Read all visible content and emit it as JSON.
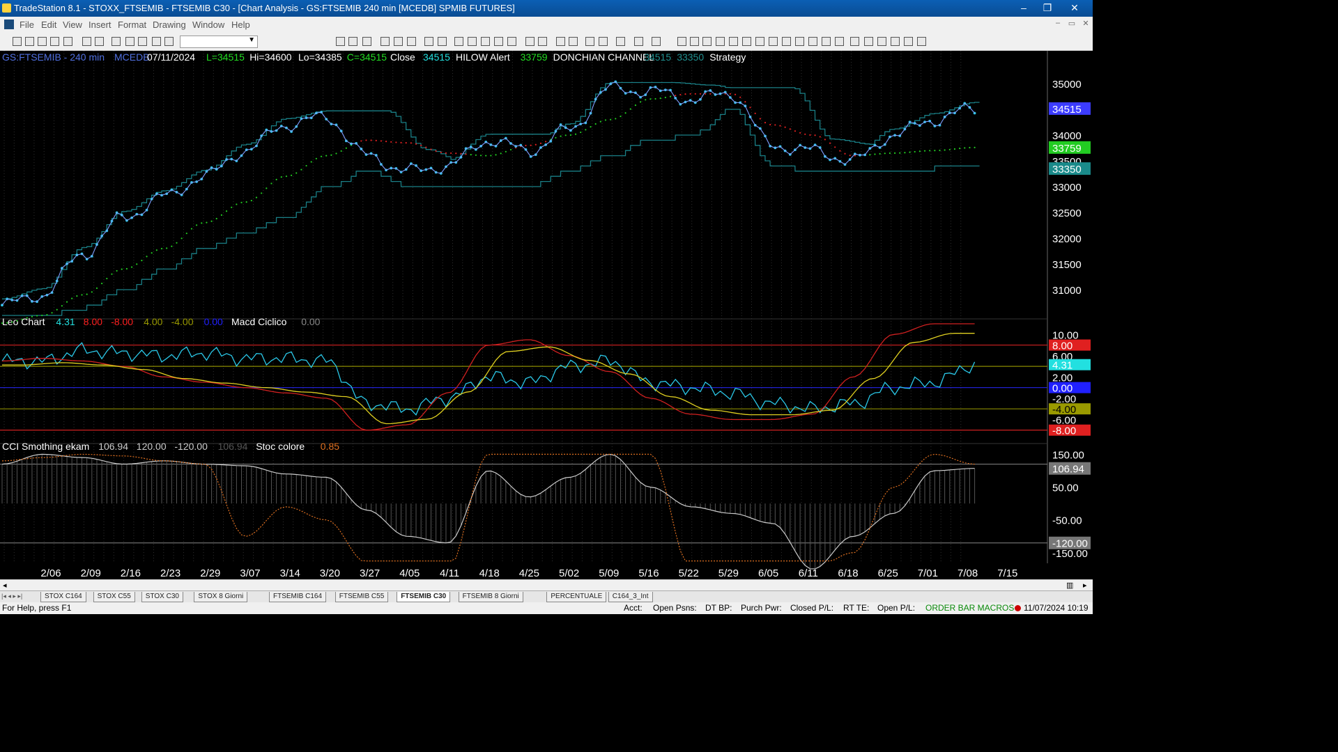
{
  "window": {
    "title": "TradeStation 8.1 - STOXX_FTSEMIB - FTSEMIB C30 - [Chart Analysis - GS:FTSEMIB  240 min  [MCEDB] SPMIB FUTURES]",
    "buttons": [
      "–",
      "❐",
      "✕"
    ]
  },
  "menu": [
    "File",
    "Edit",
    "View",
    "Insert",
    "Format",
    "Drawing",
    "Window",
    "Help"
  ],
  "mdi_buttons": [
    "–",
    "▭",
    "✕"
  ],
  "toolbar": {
    "symbol_value": ""
  },
  "header1": [
    {
      "t": "GS:FTSEMIB - 240 min",
      "c": "#4f6fe0"
    },
    {
      "t": "MCEDB",
      "c": "#4f6fe0"
    },
    {
      "t": "07/11/2024",
      "c": "#ffffff"
    },
    {
      "t": "L=34515",
      "c": "#22dd22"
    },
    {
      "t": "Hi=34600",
      "c": "#ffffff"
    },
    {
      "t": "Lo=34385",
      "c": "#ffffff"
    },
    {
      "t": "C=34515",
      "c": "#22dd22"
    },
    {
      "t": "Close",
      "c": "#ffffff"
    },
    {
      "t": "34515",
      "c": "#22e0e0"
    },
    {
      "t": "HILOW Alert",
      "c": "#ffffff"
    },
    {
      "t": "33759",
      "c": "#22dd22"
    },
    {
      "t": "DONCHIAN CHANNEL",
      "c": "#ffffff"
    },
    {
      "t": "34515",
      "c": "#1f8f8f"
    },
    {
      "t": "33350",
      "c": "#1f8f8f"
    },
    {
      "t": "Strategy",
      "c": "#ffffff"
    }
  ],
  "header2": [
    {
      "t": "Leo Chart",
      "c": "#ffffff"
    },
    {
      "t": "4.31",
      "c": "#22e0e0"
    },
    {
      "t": "8.00",
      "c": "#ff2020"
    },
    {
      "t": "-8.00",
      "c": "#ff2020"
    },
    {
      "t": "4.00",
      "c": "#9a9a00"
    },
    {
      "t": "-4.00",
      "c": "#9a9a00"
    },
    {
      "t": "0.00",
      "c": "#2020ff"
    },
    {
      "t": "Macd Ciclico",
      "c": "#ffffff"
    },
    {
      "t": "0.00",
      "c": "#888888"
    }
  ],
  "header3": [
    {
      "t": "CCI Smothing ekam",
      "c": "#ffffff"
    },
    {
      "t": "106.94",
      "c": "#cccccc"
    },
    {
      "t": "120.00",
      "c": "#cccccc"
    },
    {
      "t": "-120.00",
      "c": "#cccccc"
    },
    {
      "t": "106.94",
      "c": "#555555"
    },
    {
      "t": "Stoc colore",
      "c": "#ffffff"
    },
    {
      "t": "0.85",
      "c": "#e07020"
    }
  ],
  "colors": {
    "price": "#2ac8e8",
    "donchian": "#1a7f86",
    "red_ma": "#e02020",
    "green_ma": "#22cc22",
    "grid": "#303030"
  },
  "chart_data": [
    {
      "type": "line",
      "panel": "price",
      "x": [
        "2/06",
        "2/09",
        "2/16",
        "2/23",
        "2/29",
        "3/07",
        "3/14",
        "3/20",
        "3/27",
        "4/05",
        "4/11",
        "4/18",
        "4/25",
        "5/02",
        "5/09",
        "5/16",
        "5/22",
        "5/29",
        "6/05",
        "6/11",
        "6/18",
        "6/25",
        "7/01",
        "7/08",
        "7/15"
      ],
      "yticks": [
        31000,
        31500,
        32000,
        32500,
        33000,
        33500,
        34000,
        34500,
        35000
      ],
      "ylim": [
        30500,
        35500
      ],
      "series": [
        {
          "name": "Close",
          "values": [
            30700,
            30900,
            31700,
            32400,
            32800,
            33200,
            33700,
            34200,
            34350,
            33600,
            33300,
            33400,
            33900,
            33700,
            34100,
            34900,
            34850,
            34700,
            34800,
            33800,
            33700,
            33500,
            34000,
            34300,
            34515
          ]
        },
        {
          "name": "HILOW Alert",
          "values": [
            30350,
            30500,
            30900,
            31400,
            31800,
            32300,
            32700,
            33200,
            33600,
            33900,
            33850,
            33650,
            33600,
            33800,
            34000,
            34300,
            34700,
            34800,
            34800,
            34200,
            34000,
            33600,
            33650,
            33700,
            33759
          ]
        },
        {
          "name": "DONCHIAN CHANNEL",
          "values": [
            30450,
            30500,
            30650,
            31000,
            31400,
            31800,
            32100,
            32400,
            33000,
            33300,
            33000,
            33000,
            33000,
            33000,
            33300,
            33600,
            33900,
            34000,
            34500,
            33400,
            33300,
            33300,
            33300,
            33350,
            33350
          ]
        }
      ],
      "labels": [
        {
          "t": "34515",
          "v": 34515,
          "c": "#3c3cff"
        },
        {
          "t": "33759",
          "v": 33759,
          "c": "#22cc22"
        },
        {
          "t": "33350",
          "v": 33350,
          "c": "#1a8a8a"
        }
      ]
    },
    {
      "type": "line",
      "panel": "Leo Chart",
      "yticks": [
        10,
        6,
        2,
        -2,
        -6
      ],
      "ytick_labels": [
        "10.00",
        "6.00",
        "2.00",
        "-2.00",
        "-6.00"
      ],
      "ylim": [
        -10,
        12
      ],
      "hlines": [
        8,
        4,
        0,
        -4,
        -8
      ],
      "series": [
        {
          "name": "Leo Chart",
          "values": [
            5,
            5,
            7,
            6.5,
            6,
            6.5,
            5.5,
            5.5,
            5,
            -3,
            -4,
            -2,
            2,
            1,
            4,
            5,
            1,
            0,
            -1,
            -3,
            -4,
            -3,
            0,
            1,
            4.31
          ]
        },
        {
          "name": "Macd Ciclico",
          "values": [
            5,
            5.5,
            5,
            4,
            2,
            1,
            0,
            -1,
            -2,
            -8,
            -7,
            -1,
            8,
            9,
            6,
            3,
            -2,
            -5,
            -6,
            -6,
            -5,
            2,
            10,
            12,
            12
          ]
        }
      ],
      "labels": [
        {
          "t": "8.00",
          "v": 8,
          "c": "#e02020"
        },
        {
          "t": "4.31",
          "v": 4.31,
          "c": "#22e0e0"
        },
        {
          "t": "0.00",
          "v": 0,
          "c": "#2020ff"
        },
        {
          "t": "-4.00",
          "v": -4,
          "c": "#9a9a00"
        },
        {
          "t": "-8.00",
          "v": -8,
          "c": "#e02020"
        }
      ]
    },
    {
      "type": "line",
      "panel": "CCI Smothing ekam",
      "yticks": [
        150,
        50,
        -50,
        -150
      ],
      "ytick_labels": [
        "150.00",
        "50.00",
        "-50.00",
        "-150.00"
      ],
      "ylim": [
        -180,
        170
      ],
      "hlines": [
        120,
        -120
      ],
      "series": [
        {
          "name": "CCI Smothing ekam",
          "values": [
            120,
            150,
            140,
            120,
            130,
            120,
            115,
            90,
            80,
            -20,
            -100,
            -120,
            100,
            20,
            80,
            150,
            50,
            -10,
            -30,
            -60,
            -200,
            -100,
            -30,
            100,
            106.94
          ]
        },
        {
          "name": "Stoc colore",
          "values": [
            130,
            140,
            150,
            145,
            130,
            120,
            -100,
            -10,
            -50,
            -180,
            -200,
            -200,
            150,
            150,
            150,
            150,
            150,
            -200,
            -200,
            -200,
            -200,
            -150,
            50,
            150,
            120
          ]
        }
      ],
      "labels": [
        {
          "t": "106.94",
          "v": 106.94,
          "c": "#888888"
        },
        {
          "t": "-120.00",
          "v": -120,
          "c": "#888888"
        }
      ]
    }
  ],
  "tabs": [
    "STOX C164",
    "STOX C55",
    "STOX  C30",
    "STOX  8 Giorni",
    "FTSEMIB C164",
    "FTSEMIB C55",
    "FTSEMIB C30",
    "FTSEMIB  8 Giorni",
    "PERCENTUALE",
    "C164_3_Int"
  ],
  "active_tab": 6,
  "status": {
    "help": "For Help, press F1",
    "items": [
      "Acct:",
      "Open Psns:",
      "DT BP:",
      "Purch Pwr:",
      "Closed P/L:",
      "RT TE:",
      "Open P/L:"
    ],
    "macros": "ORDER BAR  MACROS",
    "datetime": "11/07/2024 10:19"
  }
}
